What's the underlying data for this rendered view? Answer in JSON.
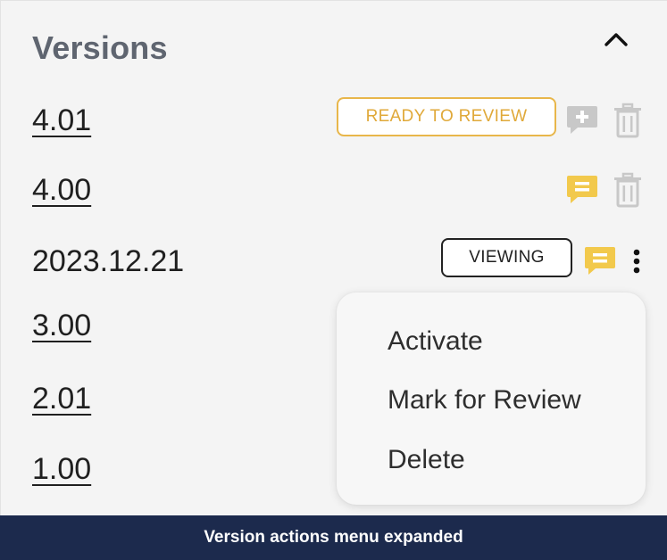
{
  "panel": {
    "title": "Versions",
    "collapse_icon": "chevron-up-icon"
  },
  "versions": [
    {
      "label": "4.01",
      "status": "READY TO REVIEW",
      "comment_icon": "add-comment-icon",
      "action_icon": "trash-icon",
      "linked": true
    },
    {
      "label": "4.00",
      "status": "",
      "comment_icon": "comment-icon",
      "action_icon": "trash-icon",
      "linked": true
    },
    {
      "label": "2023.12.21",
      "status": "VIEWING",
      "comment_icon": "comment-icon",
      "action_icon": "more-vertical-icon",
      "linked": false
    },
    {
      "label": "3.00",
      "linked": true
    },
    {
      "label": "2.01",
      "linked": true
    },
    {
      "label": "1.00",
      "linked": true
    }
  ],
  "menu": {
    "items": [
      "Activate",
      "Mark for Review",
      "Delete"
    ]
  },
  "status_bar": {
    "text": "Version actions menu expanded"
  },
  "colors": {
    "accent_yellow": "#f2c94c",
    "review_border": "#e8b64a",
    "icon_gray": "#c8c8c8",
    "title_gray": "#5f6570",
    "status_bar_bg": "#1c2a4d"
  }
}
